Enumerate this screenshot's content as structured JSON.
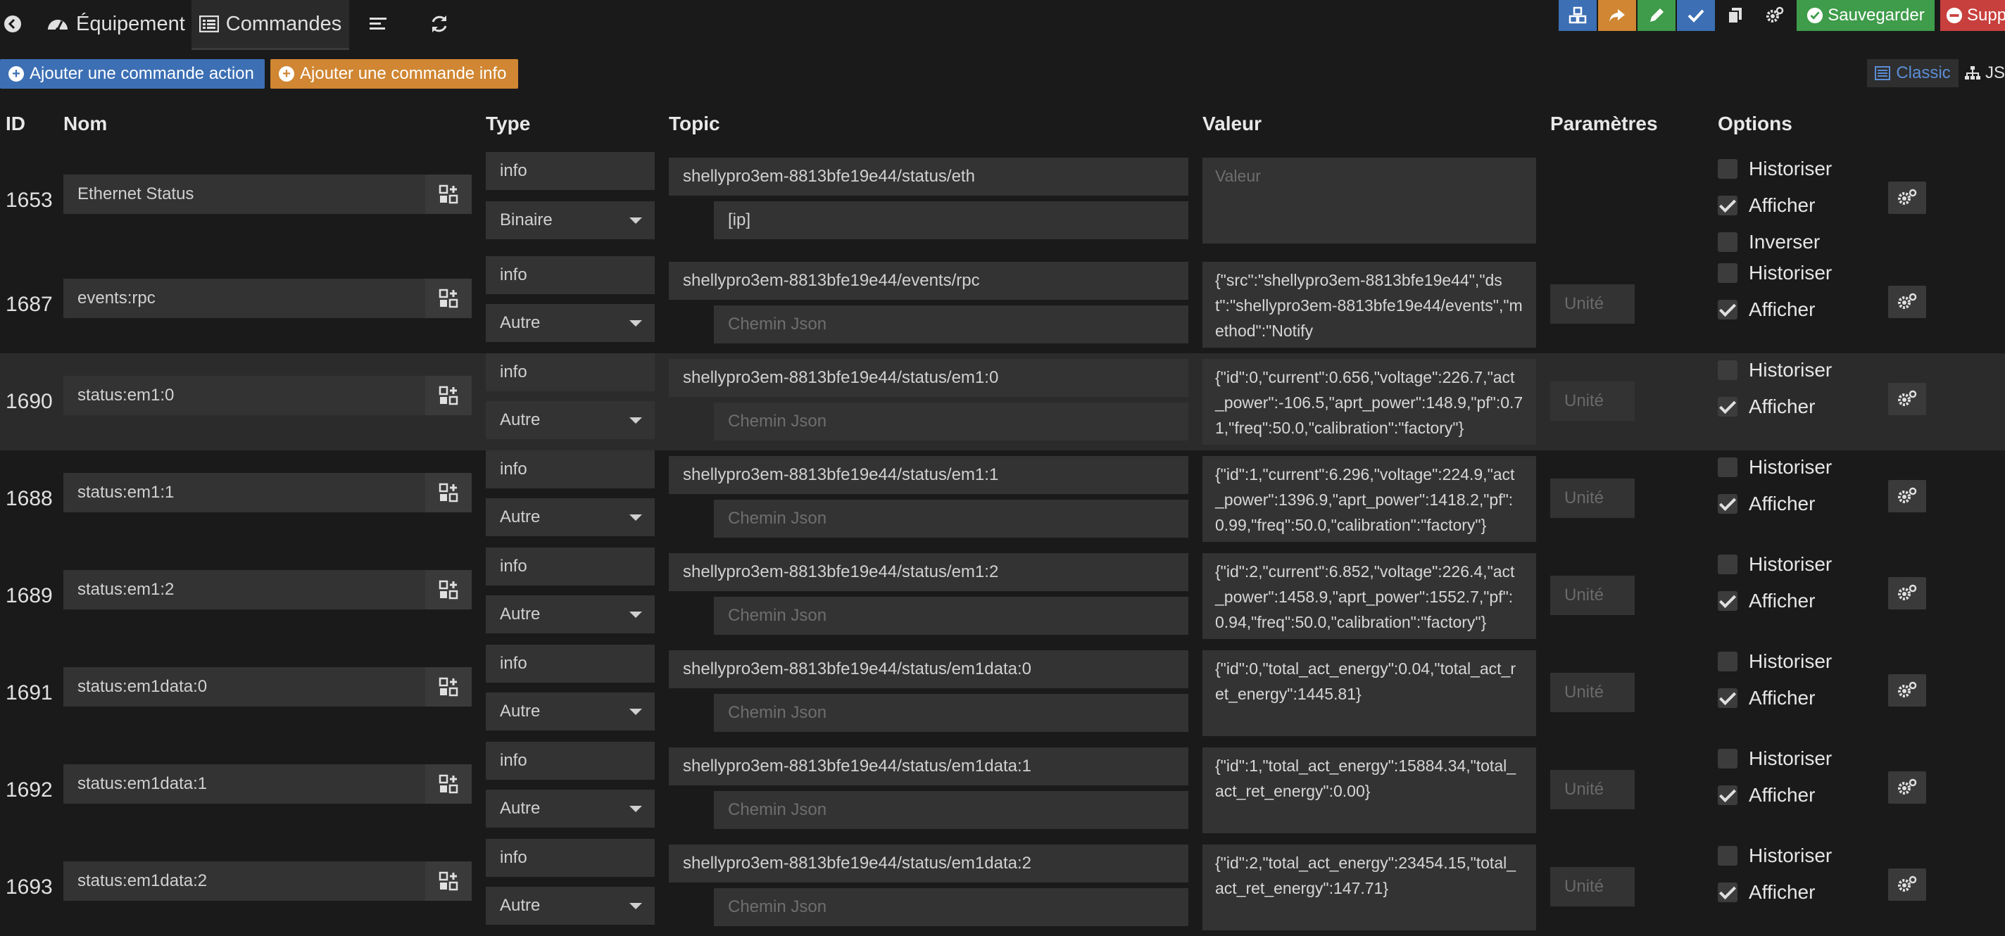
{
  "tabs": {
    "equipement": "Équipement",
    "commandes": "Commandes"
  },
  "toolbar": {
    "sauvegarder": "Sauvegarder",
    "supprimer": "Supp"
  },
  "actions": {
    "add_action": "Ajouter une commande action",
    "add_info": "Ajouter une commande info"
  },
  "view": {
    "classic": "Classic",
    "json": "JS"
  },
  "columns": {
    "id": "ID",
    "nom": "Nom",
    "type": "Type",
    "topic": "Topic",
    "valeur": "Valeur",
    "parametres": "Paramètres",
    "options": "Options"
  },
  "labels": {
    "historiser": "Historiser",
    "afficher": "Afficher",
    "inverser": "Inverser"
  },
  "placeholders": {
    "valeur": "Valeur",
    "chemin": "Chemin Json",
    "unite": "Unité"
  },
  "colors": {
    "blue": "#3c6fb4",
    "orange": "#d08632",
    "green": "#3e9c4a",
    "red": "#c8403d"
  },
  "rows": [
    {
      "id": "1653",
      "name": "Ethernet Status",
      "type": "info",
      "subtype": "Binaire",
      "topic": "shellypro3em-8813bfe19e44/status/eth",
      "json_path": "[ip]",
      "value": "",
      "historiser": false,
      "afficher": true,
      "inverser": false
    },
    {
      "id": "1687",
      "name": "events:rpc",
      "type": "info",
      "subtype": "Autre",
      "topic": "shellypro3em-8813bfe19e44/events/rpc",
      "json_path": "",
      "value": "{\"src\":\"shellypro3em-8813bfe19e44\",\"dst\":\"shellypro3em-8813bfe19e44/events\",\"method\":\"Notify",
      "historiser": false,
      "afficher": true
    },
    {
      "id": "1690",
      "name": "status:em1:0",
      "type": "info",
      "subtype": "Autre",
      "topic": "shellypro3em-8813bfe19e44/status/em1:0",
      "json_path": "",
      "value": "{\"id\":0,\"current\":0.656,\"voltage\":226.7,\"act_power\":-106.5,\"aprt_power\":148.9,\"pf\":0.71,\"freq\":50.0,\"calibration\":\"factory\"}",
      "historiser": false,
      "afficher": true
    },
    {
      "id": "1688",
      "name": "status:em1:1",
      "type": "info",
      "subtype": "Autre",
      "topic": "shellypro3em-8813bfe19e44/status/em1:1",
      "json_path": "",
      "value": "{\"id\":1,\"current\":6.296,\"voltage\":224.9,\"act_power\":1396.9,\"aprt_power\":1418.2,\"pf\":0.99,\"freq\":50.0,\"calibration\":\"factory\"}",
      "historiser": false,
      "afficher": true
    },
    {
      "id": "1689",
      "name": "status:em1:2",
      "type": "info",
      "subtype": "Autre",
      "topic": "shellypro3em-8813bfe19e44/status/em1:2",
      "json_path": "",
      "value": "{\"id\":2,\"current\":6.852,\"voltage\":226.4,\"act_power\":1458.9,\"aprt_power\":1552.7,\"pf\":0.94,\"freq\":50.0,\"calibration\":\"factory\"}",
      "historiser": false,
      "afficher": true
    },
    {
      "id": "1691",
      "name": "status:em1data:0",
      "type": "info",
      "subtype": "Autre",
      "topic": "shellypro3em-8813bfe19e44/status/em1data:0",
      "json_path": "",
      "value": "{\"id\":0,\"total_act_energy\":0.04,\"total_act_ret_energy\":1445.81}",
      "historiser": false,
      "afficher": true
    },
    {
      "id": "1692",
      "name": "status:em1data:1",
      "type": "info",
      "subtype": "Autre",
      "topic": "shellypro3em-8813bfe19e44/status/em1data:1",
      "json_path": "",
      "value": "{\"id\":1,\"total_act_energy\":15884.34,\"total_act_ret_energy\":0.00}",
      "historiser": false,
      "afficher": true
    },
    {
      "id": "1693",
      "name": "status:em1data:2",
      "type": "info",
      "subtype": "Autre",
      "topic": "shellypro3em-8813bfe19e44/status/em1data:2",
      "json_path": "",
      "value": "{\"id\":2,\"total_act_energy\":23454.15,\"total_act_ret_energy\":147.71}",
      "historiser": false,
      "afficher": true
    }
  ]
}
